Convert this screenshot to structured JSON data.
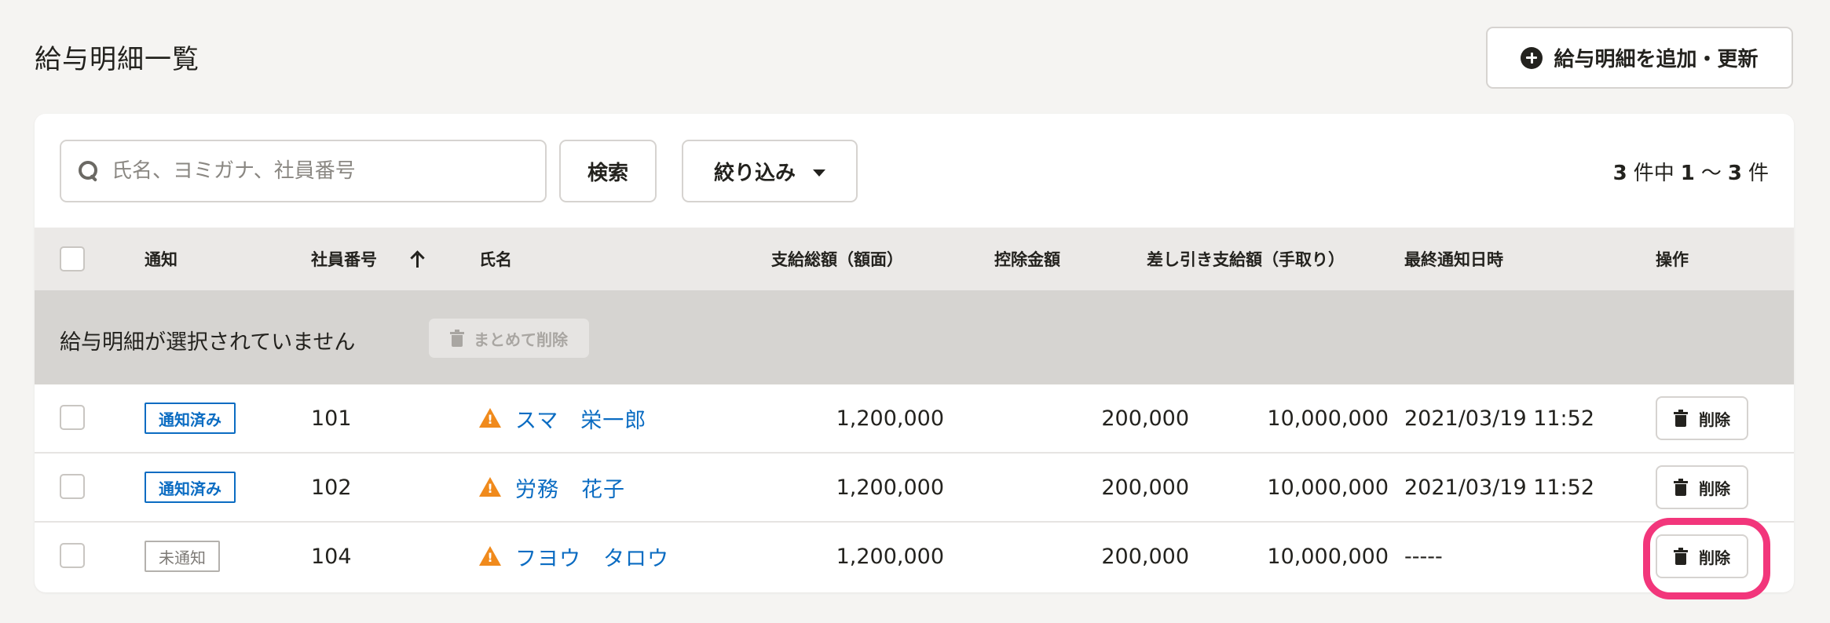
{
  "header": {
    "title": "給与明細一覧",
    "add_button_label": "給与明細を追加・更新"
  },
  "toolbar": {
    "search_placeholder": "氏名、ヨミガナ、社員番号",
    "search_button_label": "検索",
    "filter_button_label": "絞り込み",
    "pagination": {
      "total": "3",
      "sep1": "件中",
      "range_start": "1",
      "tilde": "～",
      "range_end": "3",
      "unit": "件"
    }
  },
  "table": {
    "columns": {
      "notify": "通知",
      "employee_no": "社員番号",
      "name": "氏名",
      "gross_pay": "支給総額（額面）",
      "deduction": "控除金額",
      "net_pay": "差し引き支給額（手取り）",
      "last_notified": "最終通知日時",
      "actions": "操作"
    },
    "selection_text": "給与明細が選択されていません",
    "bulk_delete_label": "まとめて削除",
    "rows": [
      {
        "status": "通知済み",
        "employee_no": "101",
        "name": "スマ　栄一郎",
        "gross_pay": "1,200,000",
        "deduction": "200,000",
        "net_pay": "10,000,000",
        "last_notified": "2021/03/19 11:52",
        "delete_label": "削除"
      },
      {
        "status": "通知済み",
        "employee_no": "102",
        "name": "労務　花子",
        "gross_pay": "1,200,000",
        "deduction": "200,000",
        "net_pay": "10,000,000",
        "last_notified": "2021/03/19 11:52",
        "delete_label": "削除"
      },
      {
        "status": "未通知",
        "employee_no": "104",
        "name": "フヨウ　タロウ",
        "gross_pay": "1,200,000",
        "deduction": "200,000",
        "net_pay": "10,000,000",
        "last_notified": "-----",
        "delete_label": "削除"
      }
    ]
  },
  "colors": {
    "link_blue": "#0b6cc2",
    "warning_orange": "#f08a1c",
    "highlight_pink": "#f2367b"
  }
}
